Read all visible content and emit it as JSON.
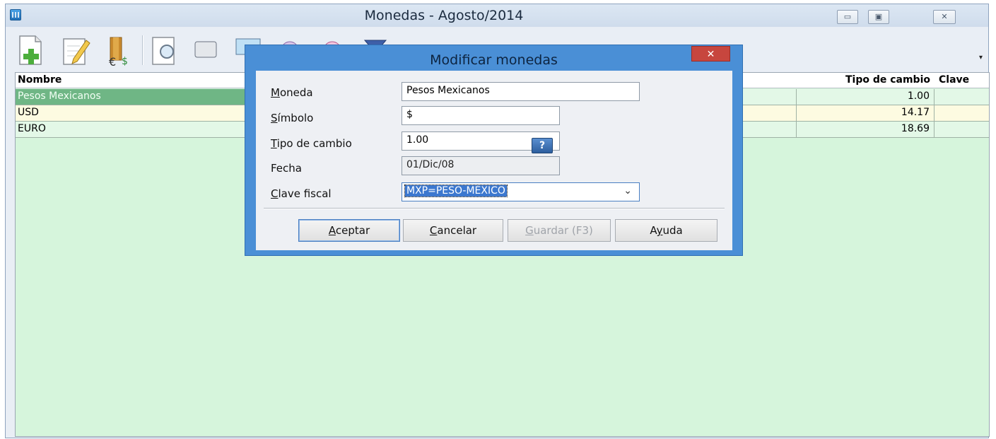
{
  "main_window": {
    "title": "Monedas - Agosto/2014",
    "controls": {
      "minimize": "▭",
      "maximize": "▣",
      "close": "✕"
    }
  },
  "toolbar": {
    "icons": [
      "new-record-icon",
      "edit-record-icon",
      "currency-exchange-icon",
      "preview-icon",
      "print-icon",
      "display-icon",
      "settings-icon",
      "fingerprint-icon",
      "filter-icon"
    ],
    "more_glyph": "▾"
  },
  "grid": {
    "columns": {
      "nombre": "Nombre",
      "tipo_de_cambio": "Tipo de cambio",
      "clave": "Clave"
    },
    "rows": [
      {
        "nombre": "Pesos Mexicanos",
        "tipo_de_cambio": "1.00"
      },
      {
        "nombre": "USD",
        "tipo_de_cambio": "14.17"
      },
      {
        "nombre": "EURO",
        "tipo_de_cambio": "18.69"
      }
    ]
  },
  "dialog": {
    "title": "Modificar monedas",
    "close_glyph": "✕",
    "fields": {
      "moneda": {
        "mnemonic": "M",
        "rest": "oneda",
        "value": "Pesos Mexicanos"
      },
      "simbolo": {
        "mnemonic": "S",
        "rest": "ímbolo",
        "value": "$"
      },
      "tipo_de_cambio": {
        "mnemonic": "T",
        "rest": "ipo de cambio",
        "value": "1.00",
        "help": "?"
      },
      "fecha": {
        "label": "Fecha",
        "value": "01/Dic/08"
      },
      "clave_fiscal": {
        "mnemonic": "C",
        "rest": "lave fiscal",
        "value": "MXP=PESO-MÉXICO",
        "arrow": "⌄"
      }
    },
    "buttons": {
      "aceptar": {
        "mnemonic": "A",
        "rest": "ceptar"
      },
      "cancelar": {
        "mnemonic": "C",
        "rest": "ancelar"
      },
      "guardar": {
        "mnemonic": "G",
        "rest": "uardar (F3)"
      },
      "ayuda": {
        "pre": "A",
        "mnemonic": "y",
        "rest": "uda"
      }
    }
  },
  "colors": {
    "grid_background": "#d6f5dc",
    "selected_row": "#6fb685",
    "alt_row": "#fdfbe1",
    "dialog_frame": "#4a8fd6",
    "dialog_close": "#c7463e"
  }
}
